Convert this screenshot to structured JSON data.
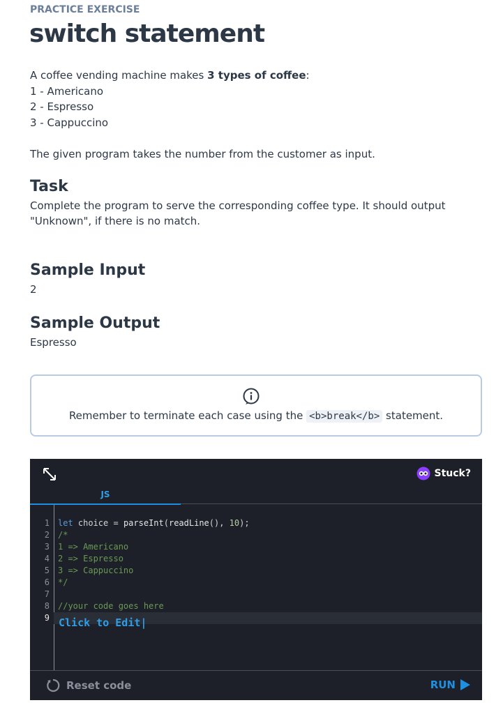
{
  "header": {
    "eyebrow": "PRACTICE EXERCISE",
    "title": "switch statement"
  },
  "description": {
    "intro_prefix": "A coffee vending machine makes ",
    "intro_bold": "3 types of coffee",
    "intro_suffix": ":",
    "options": [
      "1 - Americano",
      "2 - Espresso",
      "3 - Cappuccino"
    ],
    "program_note": "The given program takes the number from the customer as input."
  },
  "task": {
    "heading": "Task",
    "text": "Complete the program to serve the corresponding coffee type. It should output \"Unknown\", if there is no match."
  },
  "sample_input": {
    "heading": "Sample Input",
    "value": "2"
  },
  "sample_output": {
    "heading": "Sample Output",
    "value": "Espresso"
  },
  "hint": {
    "icon": "info-icon",
    "prefix": "Remember to terminate each case using the ",
    "code": "<b>break</b>",
    "suffix": " statement."
  },
  "editor": {
    "stuck_label": "Stuck?",
    "tab_label": "JS",
    "line_numbers": [
      "1",
      "2",
      "3",
      "4",
      "5",
      "6",
      "7",
      "8",
      "9"
    ],
    "code_lines": [
      "let choice = parseInt(readLine(), 10);",
      "/*",
      "1 => Americano",
      "2 => Espresso",
      "3 => Cappuccino",
      "*/",
      "",
      "//your code goes here",
      ""
    ],
    "click_to_edit": "Click to Edit|",
    "reset_label": "Reset code",
    "run_label": "RUN"
  },
  "colors": {
    "accent": "#1e8fe1",
    "editor_bg": "#1d2028",
    "hint_border": "#b8cbe4",
    "text": "#2d3846"
  }
}
